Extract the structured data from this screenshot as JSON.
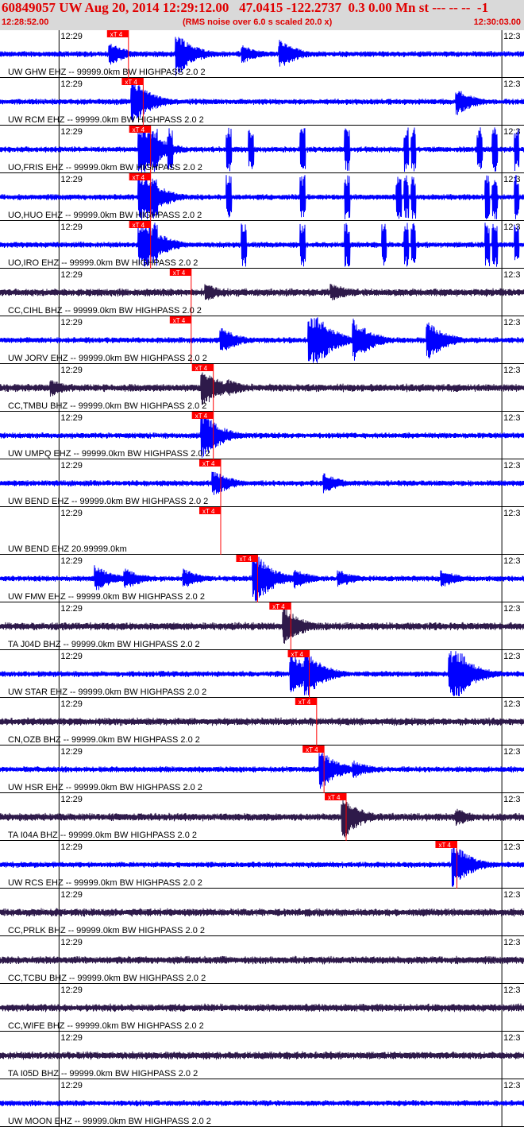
{
  "header": {
    "title": "60849057 UW Aug 20, 2014 12:29:12.00   47.0415 -122.2737  0.3 0.00 Mn st --- -- --  -1",
    "start_time": "12:28:52.00",
    "note": "(RMS noise over 6.0 s scaled 20.0 x)",
    "end_time": "12:30:03.00"
  },
  "colors": {
    "header_bg": "#d9d9d9",
    "header_text": "#e00000",
    "trace_blue": "#0000ff",
    "trace_purple": "#2e1a4a",
    "pick": "#ff0000",
    "grid": "#000000"
  },
  "chart_data": {
    "type": "line",
    "x_range_seconds": [
      0,
      71
    ],
    "minute_tick_labels": [
      "12:29",
      "12:3"
    ],
    "pick_label": "xT 4",
    "traces": [
      {
        "label": "UW GHW EHZ -- 99999.0km BW  HIGHPASS  2.0  2",
        "color": "blue",
        "pick_s": 14.5,
        "events": [
          [
            15,
            1.0
          ],
          [
            24,
            2.0
          ],
          [
            33,
            0.8
          ],
          [
            38,
            1.3
          ]
        ]
      },
      {
        "label": "UW RCM EHZ -- 99999.0km BW  HIGHPASS  2.0  2",
        "color": "blue",
        "pick_s": 16.5,
        "events": [
          [
            18,
            2.2
          ],
          [
            62,
            1.2
          ]
        ]
      },
      {
        "label": "UO,FRIS EHZ -- 99999.0km BW  HIGHPASS  2.0  2",
        "color": "blue",
        "pick_s": 17.5,
        "events": [
          [
            19,
            3.0
          ]
        ],
        "bursts": [
          21,
          23,
          31,
          34,
          41,
          47,
          55,
          56,
          65,
          67,
          70
        ]
      },
      {
        "label": "UO,HUO EHZ -- 99999.0km BW  HIGHPASS  2.0  2",
        "color": "blue",
        "pick_s": 17.5,
        "events": [
          [
            19,
            3.0
          ]
        ],
        "bursts": [
          21,
          31,
          41,
          47,
          54,
          55,
          56,
          66,
          67,
          70
        ]
      },
      {
        "label": "UO,IRO EHZ -- 99999.0km BW  HIGHPASS  2.0  2",
        "color": "blue",
        "pick_s": 17.5,
        "events": [
          [
            19,
            3.0
          ]
        ],
        "bursts": [
          21,
          33,
          41,
          47,
          52,
          55,
          56,
          66,
          67,
          70
        ]
      },
      {
        "label": "CC,CIHL BHZ -- 99999.0km BW  HIGHPASS  2.0  2",
        "color": "purple",
        "pick_s": 23,
        "events": [
          [
            28,
            0.8
          ],
          [
            45,
            0.9
          ]
        ]
      },
      {
        "label": "UW JORV EHZ -- 99999.0km BW  HIGHPASS  2.0  2",
        "color": "blue",
        "pick_s": 23,
        "events": [
          [
            30,
            1.2
          ],
          [
            42,
            3.5
          ],
          [
            48,
            2.0
          ],
          [
            58,
            1.8
          ]
        ]
      },
      {
        "label": "CC,TMBU BHZ -- 99999.0km BW  HIGHPASS  2.0  2",
        "color": "purple",
        "pick_s": 26,
        "events": [
          [
            7,
            0.8
          ],
          [
            27.5,
            1.8
          ],
          [
            31,
            0.8
          ]
        ]
      },
      {
        "label": "UW UMPQ EHZ -- 99999.0km BW  HIGHPASS  2.0  2",
        "color": "blue",
        "pick_s": 26,
        "events": [
          [
            27.5,
            2.2
          ]
        ]
      },
      {
        "label": "UW BEND EHZ -- 99999.0km BW  HIGHPASS  2.0  2",
        "color": "blue",
        "pick_s": 27,
        "events": [
          [
            29,
            1.2
          ],
          [
            44,
            0.9
          ]
        ]
      },
      {
        "label": "UW BEND EHZ 20.99999.0km",
        "color": "blue",
        "pick_s": 27,
        "flat": true,
        "events": []
      },
      {
        "label": "UW FMW EHZ -- 99999.0km BW  HIGHPASS  2.0  2",
        "color": "blue",
        "pick_s": 32,
        "events": [
          [
            13,
            1.2
          ],
          [
            17,
            1.0
          ],
          [
            25,
            0.9
          ],
          [
            34.5,
            2.5
          ],
          [
            40,
            0.9
          ],
          [
            46,
            0.8
          ],
          [
            60,
            0.8
          ]
        ]
      },
      {
        "label": "TA J04D BHZ -- 99999.0km BW  HIGHPASS  2.0  2",
        "color": "purple",
        "pick_s": 36.5,
        "events": [
          [
            38.5,
            1.8
          ]
        ]
      },
      {
        "label": "UW STAR EHZ -- 99999.0km BW  HIGHPASS  2.0  2",
        "color": "blue",
        "pick_s": 39,
        "events": [
          [
            39.5,
            2.0
          ],
          [
            41.5,
            2.2
          ],
          [
            61,
            3.5
          ]
        ]
      },
      {
        "label": "CN,OZB BHZ -- 99999.0km BW  HIGHPASS  2.0  2",
        "color": "purple",
        "pick_s": 40,
        "events": []
      },
      {
        "label": "UW HSR EHZ -- 99999.0km BW  HIGHPASS  2.0  2",
        "color": "blue",
        "pick_s": 41,
        "events": [
          [
            43.5,
            1.8
          ],
          [
            48,
            0.8
          ]
        ]
      },
      {
        "label": "TA I04A BHZ -- 99999.0km BW  HIGHPASS  2.0  2",
        "color": "purple",
        "pick_s": 44,
        "events": [
          [
            46.5,
            2.0
          ],
          [
            62,
            0.8
          ]
        ]
      },
      {
        "label": "UW RCS EHZ -- 99999.0km BW  HIGHPASS  2.0  2",
        "color": "blue",
        "pick_s": 59,
        "events": [
          [
            61.5,
            2.0
          ]
        ]
      },
      {
        "label": "CC,PRLK BHZ -- 99999.0km BW  HIGHPASS  2.0  2",
        "color": "purple",
        "pick_s": null,
        "events": []
      },
      {
        "label": "CC,TCBU BHZ -- 99999.0km BW  HIGHPASS  2.0  2",
        "color": "purple",
        "pick_s": null,
        "events": []
      },
      {
        "label": "CC,WIFE BHZ -- 99999.0km BW  HIGHPASS  2.0  2",
        "color": "purple",
        "pick_s": null,
        "events": []
      },
      {
        "label": "TA I05D BHZ -- 99999.0km BW  HIGHPASS  2.0  2",
        "color": "purple",
        "pick_s": null,
        "events": []
      },
      {
        "label": "UW MOON EHZ -- 99999.0km BW  HIGHPASS  2.0  2",
        "color": "blue",
        "pick_s": null,
        "events": []
      }
    ]
  }
}
